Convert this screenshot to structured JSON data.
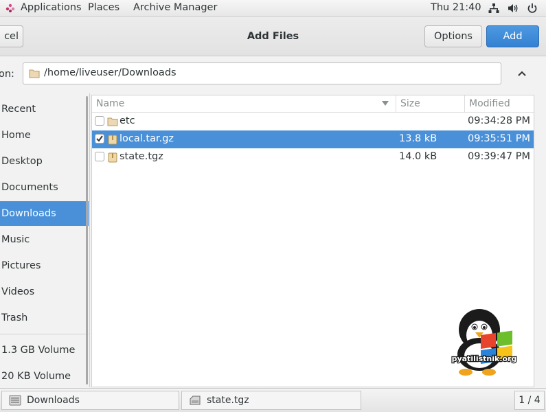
{
  "topbar": {
    "applications": "Applications",
    "places": "Places",
    "archive_manager": "Archive Manager",
    "clock": "Thu 21:40",
    "tray_icons": [
      "network-icon",
      "volume-icon",
      "power-icon"
    ]
  },
  "header": {
    "cancel_label": "cel",
    "title": "Add Files",
    "options_label": "Options",
    "add_label": "Add",
    "accent_color": "#3584e4"
  },
  "location": {
    "label": "on:",
    "path": "/home/liveuser/Downloads"
  },
  "sidebar": {
    "items": [
      {
        "label": "Recent"
      },
      {
        "label": "Home"
      },
      {
        "label": "Desktop"
      },
      {
        "label": "Documents"
      },
      {
        "label": "Downloads"
      },
      {
        "label": "Music"
      },
      {
        "label": "Pictures"
      },
      {
        "label": "Videos"
      },
      {
        "label": "Trash"
      }
    ],
    "volumes": [
      {
        "label": "1.3 GB Volume"
      },
      {
        "label": "20 KB Volume"
      }
    ],
    "selected": "Downloads"
  },
  "filelist": {
    "columns": {
      "name": "Name",
      "size": "Size",
      "modified": "Modified"
    },
    "rows": [
      {
        "name": "etc",
        "size": "",
        "modified": "09:34:28 PM",
        "type": "folder",
        "checked": false
      },
      {
        "name": "local.tar.gz",
        "size": "13.8 kB",
        "modified": "09:35:51 PM",
        "type": "archive",
        "checked": true
      },
      {
        "name": "state.tgz",
        "size": "14.0 kB",
        "modified": "09:39:47 PM",
        "type": "archive",
        "checked": false
      }
    ],
    "selected_row": "local.tar.gz"
  },
  "watermark": {
    "text": "pyatilistnik.org"
  },
  "taskbar": {
    "tasks": [
      {
        "label": "Downloads",
        "icon": "file-manager-icon"
      },
      {
        "label": "state.tgz",
        "icon": "archive-manager-icon"
      }
    ],
    "workspace": "1 / 4"
  }
}
